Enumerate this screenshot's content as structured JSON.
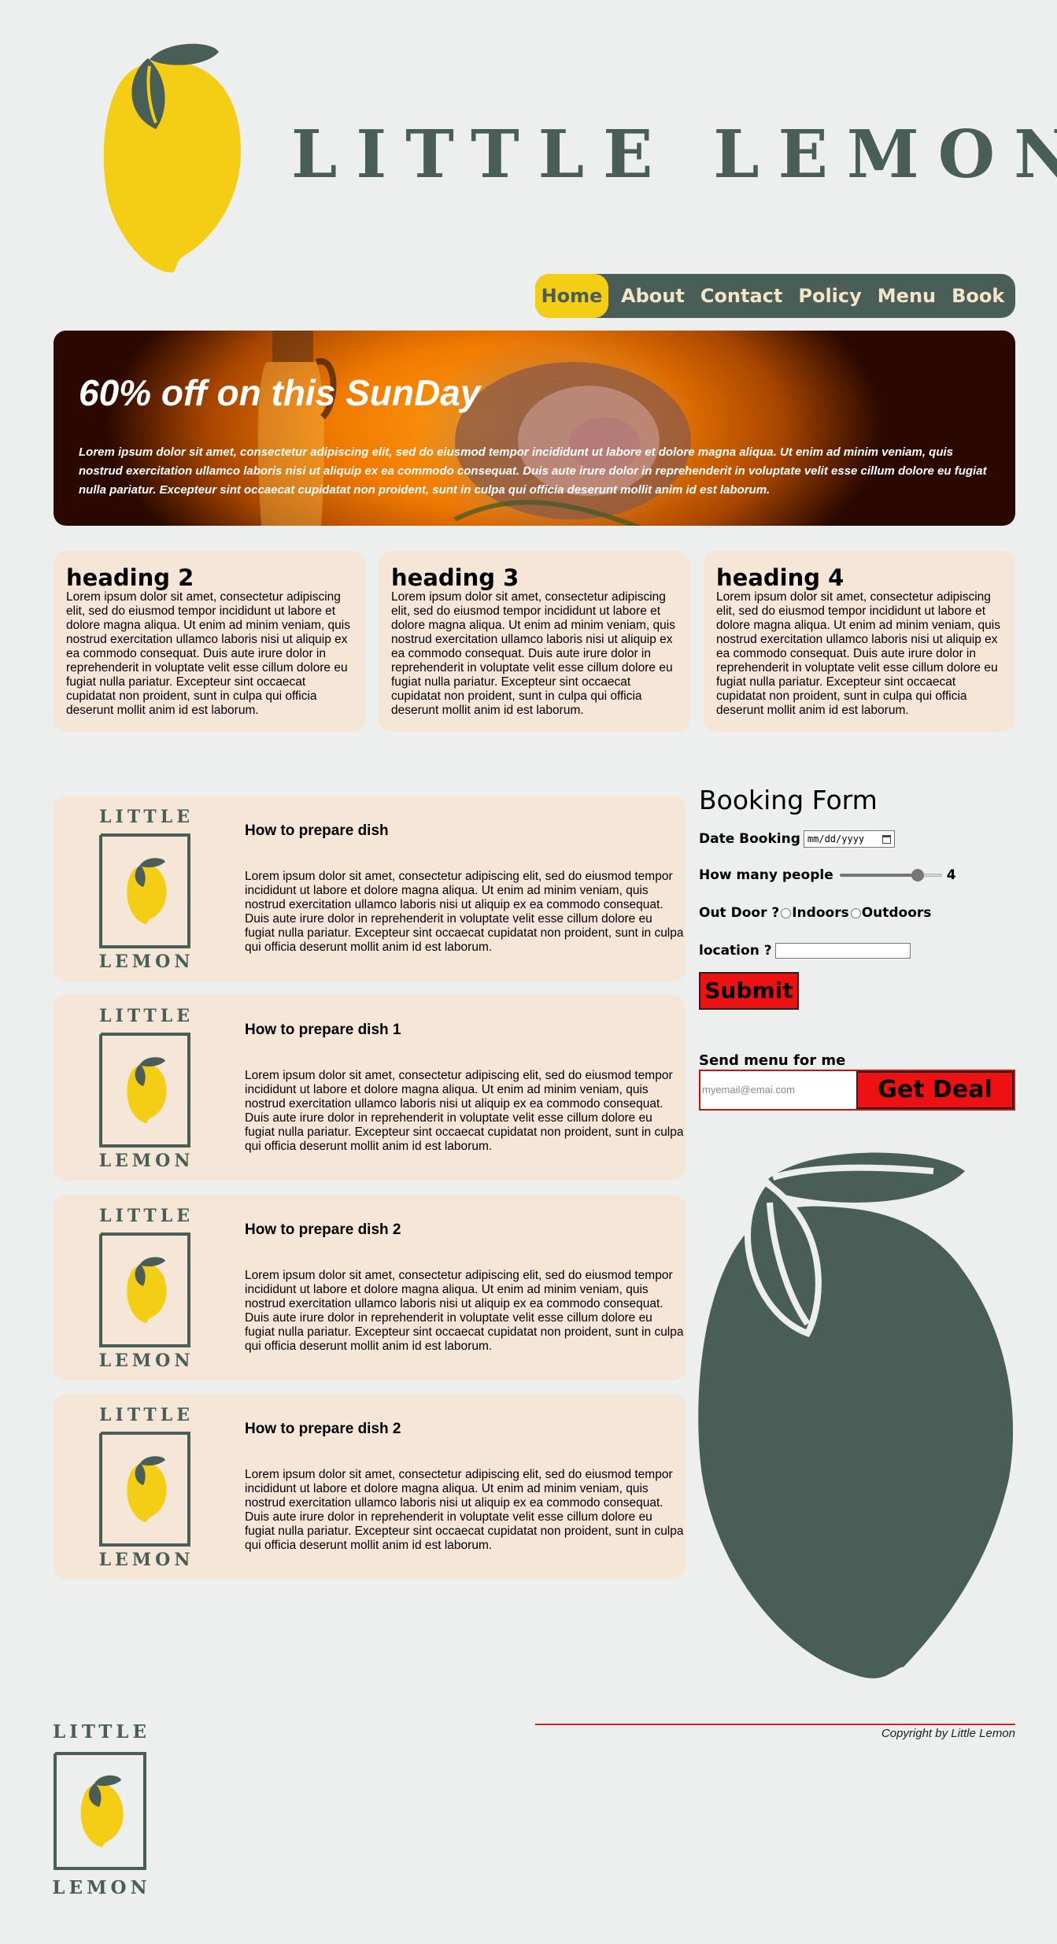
{
  "brand": {
    "title": "LITTLE LEMON",
    "logo_word_top": "LITTLE",
    "logo_word_bottom": "LEMON",
    "colors": {
      "green": "#495e57",
      "yellow": "#f4ce14",
      "cream": "#f5e6d8",
      "red": "#ee1111"
    }
  },
  "nav": {
    "items": [
      {
        "label": "Home",
        "active": true
      },
      {
        "label": "About"
      },
      {
        "label": "Contact"
      },
      {
        "label": "Policy"
      },
      {
        "label": "Menu"
      },
      {
        "label": "Book"
      }
    ]
  },
  "hero": {
    "title": "60% off on this SunDay",
    "text": "Lorem ipsum dolor sit amet, consectetur adipiscing elit, sed do eiusmod tempor incididunt ut labore et dolore magna aliqua. Ut enim ad minim veniam, quis nostrud exercitation ullamco laboris nisi ut aliquip ex ea commodo consequat. Duis aute irure dolor in reprehenderit in voluptate velit esse cillum dolore eu fugiat nulla pariatur. Excepteur sint occaecat cupidatat non proident, sunt in culpa qui officia deserunt mollit anim id est laborum."
  },
  "cards": [
    {
      "heading": "heading 2",
      "text": "Lorem ipsum dolor sit amet, consectetur adipiscing elit, sed do eiusmod tempor incididunt ut labore et dolore magna aliqua. Ut enim ad minim veniam, quis nostrud exercitation ullamco laboris nisi ut aliquip ex ea commodo consequat. Duis aute irure dolor in reprehenderit in voluptate velit esse cillum dolore eu fugiat nulla pariatur. Excepteur sint occaecat cupidatat non proident, sunt in culpa qui officia deserunt mollit anim id est laborum."
    },
    {
      "heading": "heading 3",
      "text": "Lorem ipsum dolor sit amet, consectetur adipiscing elit, sed do eiusmod tempor incididunt ut labore et dolore magna aliqua. Ut enim ad minim veniam, quis nostrud exercitation ullamco laboris nisi ut aliquip ex ea commodo consequat. Duis aute irure dolor in reprehenderit in voluptate velit esse cillum dolore eu fugiat nulla pariatur. Excepteur sint occaecat cupidatat non proident, sunt in culpa qui officia deserunt mollit anim id est laborum."
    },
    {
      "heading": "heading 4",
      "text": "Lorem ipsum dolor sit amet, consectetur adipiscing elit, sed do eiusmod tempor incididunt ut labore et dolore magna aliqua. Ut enim ad minim veniam, quis nostrud exercitation ullamco laboris nisi ut aliquip ex ea commodo consequat. Duis aute irure dolor in reprehenderit in voluptate velit esse cillum dolore eu fugiat nulla pariatur. Excepteur sint occaecat cupidatat non proident, sunt in culpa qui officia deserunt mollit anim id est laborum."
    }
  ],
  "dishes": [
    {
      "title": "How to prepare dish",
      "text": "Lorem ipsum dolor sit amet, consectetur adipiscing elit, sed do eiusmod tempor incididunt ut labore et dolore magna aliqua. Ut enim ad minim veniam, quis nostrud exercitation ullamco laboris nisi ut aliquip ex ea commodo consequat. Duis aute irure dolor in reprehenderit in voluptate velit esse cillum dolore eu fugiat nulla pariatur. Excepteur sint occaecat cupidatat non proident, sunt in culpa qui officia deserunt mollit anim id est laborum."
    },
    {
      "title": "How to prepare dish 1",
      "text": "Lorem ipsum dolor sit amet, consectetur adipiscing elit, sed do eiusmod tempor incididunt ut labore et dolore magna aliqua. Ut enim ad minim veniam, quis nostrud exercitation ullamco laboris nisi ut aliquip ex ea commodo consequat. Duis aute irure dolor in reprehenderit in voluptate velit esse cillum dolore eu fugiat nulla pariatur. Excepteur sint occaecat cupidatat non proident, sunt in culpa qui officia deserunt mollit anim id est laborum."
    },
    {
      "title": "How to prepare dish 2",
      "text": "Lorem ipsum dolor sit amet, consectetur adipiscing elit, sed do eiusmod tempor incididunt ut labore et dolore magna aliqua. Ut enim ad minim veniam, quis nostrud exercitation ullamco laboris nisi ut aliquip ex ea commodo consequat. Duis aute irure dolor in reprehenderit in voluptate velit esse cillum dolore eu fugiat nulla pariatur. Excepteur sint occaecat cupidatat non proident, sunt in culpa qui officia deserunt mollit anim id est laborum."
    },
    {
      "title": "How to prepare dish 2",
      "text": "Lorem ipsum dolor sit amet, consectetur adipiscing elit, sed do eiusmod tempor incididunt ut labore et dolore magna aliqua. Ut enim ad minim veniam, quis nostrud exercitation ullamco laboris nisi ut aliquip ex ea commodo consequat. Duis aute irure dolor in reprehenderit in voluptate velit esse cillum dolore eu fugiat nulla pariatur. Excepteur sint occaecat cupidatat non proident, sunt in culpa qui officia deserunt mollit anim id est laborum."
    }
  ],
  "booking": {
    "title": "Booking Form",
    "date_label": "Date Booking",
    "date_placeholder": "mm/dd/yyyy",
    "people_label": "How many people",
    "people_value": "4",
    "people_fraction": 0.8,
    "outdoor_label": "Out Door ?",
    "option_indoors": "Indoors",
    "option_outdoors": "Outdoors",
    "location_label": "location ?",
    "location_value": "",
    "submit_label": "Submit",
    "send_label": "Send menu for me",
    "email_placeholder": "myemail@emai.com",
    "deal_label": "Get Deal"
  },
  "footer": {
    "copyright": "Copyright by Little Lemon"
  }
}
